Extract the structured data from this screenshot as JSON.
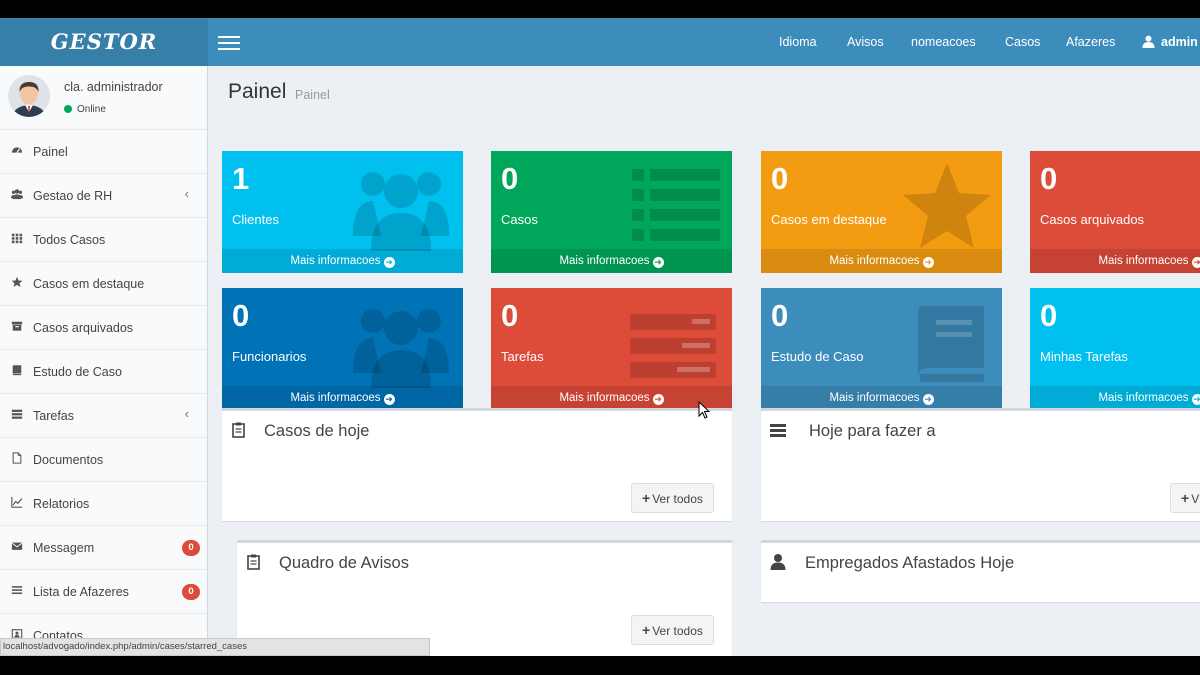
{
  "header": {
    "logo": "GESTOR",
    "nav": [
      "Idioma",
      "Avisos",
      "nomeacoes",
      "Casos",
      "Afazeres"
    ],
    "user": "admin"
  },
  "user_panel": {
    "name": "cla. administrador",
    "status": "Online"
  },
  "sidebar": {
    "items": [
      {
        "label": "Painel",
        "icon": "dashboard-icon"
      },
      {
        "label": "Gestao de RH",
        "icon": "users-icon",
        "chevron": "‹"
      },
      {
        "label": "Todos Casos",
        "icon": "grid-icon"
      },
      {
        "label": "Casos em destaque",
        "icon": "star-icon"
      },
      {
        "label": "Casos arquivados",
        "icon": "archive-icon"
      },
      {
        "label": "Estudo de Caso",
        "icon": "book-icon"
      },
      {
        "label": "Tarefas",
        "icon": "tasks-icon",
        "chevron": "‹"
      },
      {
        "label": "Documentos",
        "icon": "file-icon"
      },
      {
        "label": "Relatorios",
        "icon": "line-chart-icon"
      },
      {
        "label": "Messagem",
        "icon": "envelope-icon",
        "badge": "0"
      },
      {
        "label": "Lista de Afazeres",
        "icon": "list-icon",
        "badge": "0"
      },
      {
        "label": "Contatos",
        "icon": "contacts-icon"
      }
    ]
  },
  "page": {
    "title": "Painel",
    "subtitle": "Painel"
  },
  "boxes": [
    {
      "value": "1",
      "label": "Clientes",
      "color": "#00c0ef",
      "icon": "users-icon"
    },
    {
      "value": "0",
      "label": "Casos",
      "color": "#00a65a",
      "icon": "list-icon"
    },
    {
      "value": "0",
      "label": "Casos em destaque",
      "color": "#f39c12",
      "icon": "star-icon"
    },
    {
      "value": "0",
      "label": "Casos arquivados",
      "color": "#dd4b39",
      "icon": "archive-icon"
    },
    {
      "value": "0",
      "label": "Funcionarios",
      "color": "#0073b7",
      "icon": "users-icon"
    },
    {
      "value": "0",
      "label": "Tarefas",
      "color": "#dd4b39",
      "icon": "tasks-icon"
    },
    {
      "value": "0",
      "label": "Estudo de Caso",
      "color": "#3c8dbc",
      "icon": "book-icon"
    },
    {
      "value": "0",
      "label": "Minhas Tarefas",
      "color": "#00c0ef",
      "icon": "tasks-icon"
    }
  ],
  "more_info": "Mais informacoes",
  "panels": {
    "casos_hoje": "Casos de hoje",
    "hoje_fazer": "Hoje para fazer a",
    "quadro_avisos": "Quadro de Avisos",
    "empregados": "Empregados Afastados Hoje",
    "ver_todos": "Ver todos",
    "ver_todos_partial": "V"
  },
  "statusbar": "localhost/advogado/index.php/admin/cases/starred_cases"
}
